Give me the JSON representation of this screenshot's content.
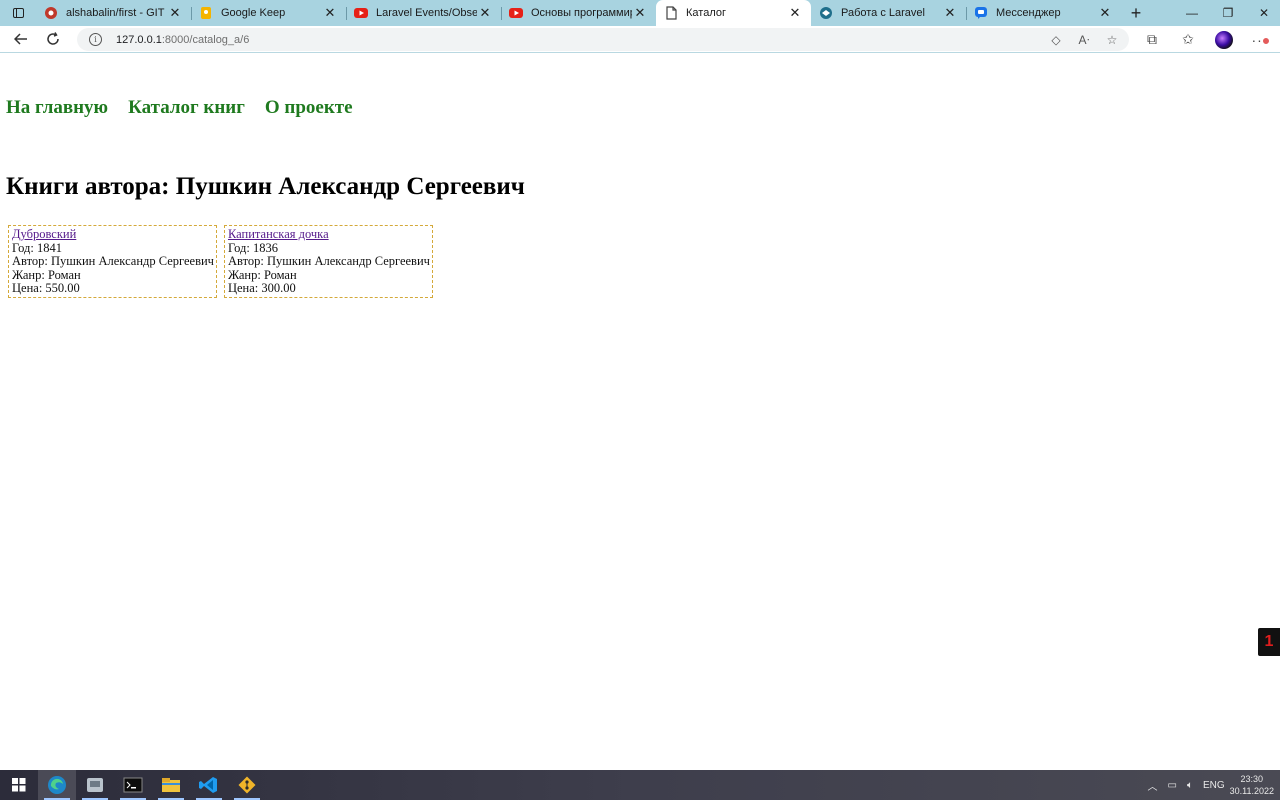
{
  "browser": {
    "tabs": [
      {
        "title": "alshabalin/first - GIT Forla",
        "icon": "git-forge-favicon",
        "active": false
      },
      {
        "title": "Google Keep",
        "icon": "google-keep-favicon",
        "active": false
      },
      {
        "title": "Laravel Events/Observers",
        "icon": "youtube-favicon",
        "active": false
      },
      {
        "title": "Основы программирова",
        "icon": "youtube-favicon",
        "active": false
      },
      {
        "title": "Каталог",
        "icon": "page-icon",
        "active": true
      },
      {
        "title": "Работа с Laravel",
        "icon": "laravel-course-favicon",
        "active": false
      },
      {
        "title": "Мессенджер",
        "icon": "messenger-favicon",
        "active": false
      }
    ],
    "url": {
      "host": "127.0.0.1",
      "path": ":8000/catalog_a/6"
    }
  },
  "page": {
    "nav": [
      "На главную",
      "Каталог книг",
      "О проекте"
    ],
    "heading": "Книги автора: Пушкин Александр Сергеевич",
    "books": [
      {
        "title": "Дубровский",
        "year": "Год: 1841",
        "author": "Автор: Пушкин Александр Сергеевич",
        "genre": "Жанр: Роман",
        "price": "Цена: 550.00"
      },
      {
        "title": "Капитанская дочка",
        "year": "Год: 1836",
        "author": "Автор: Пушкин Александр Сергеевич",
        "genre": "Жанр: Роман",
        "price": "Цена: 300.00"
      }
    ],
    "badge": "1"
  },
  "taskbar": {
    "apps": [
      "start-button",
      "edge-icon",
      "app-icon",
      "terminal-icon",
      "file-explorer-icon",
      "vscode-icon",
      "git-icon"
    ],
    "lang": "ENG",
    "time": "23:30",
    "date": "30.11.2022"
  },
  "colors": {
    "tabstrip": "#a8d3e0",
    "nav_link": "#1f7a1f",
    "card_border": "#d4a93a",
    "visited_link": "#551a8b"
  }
}
